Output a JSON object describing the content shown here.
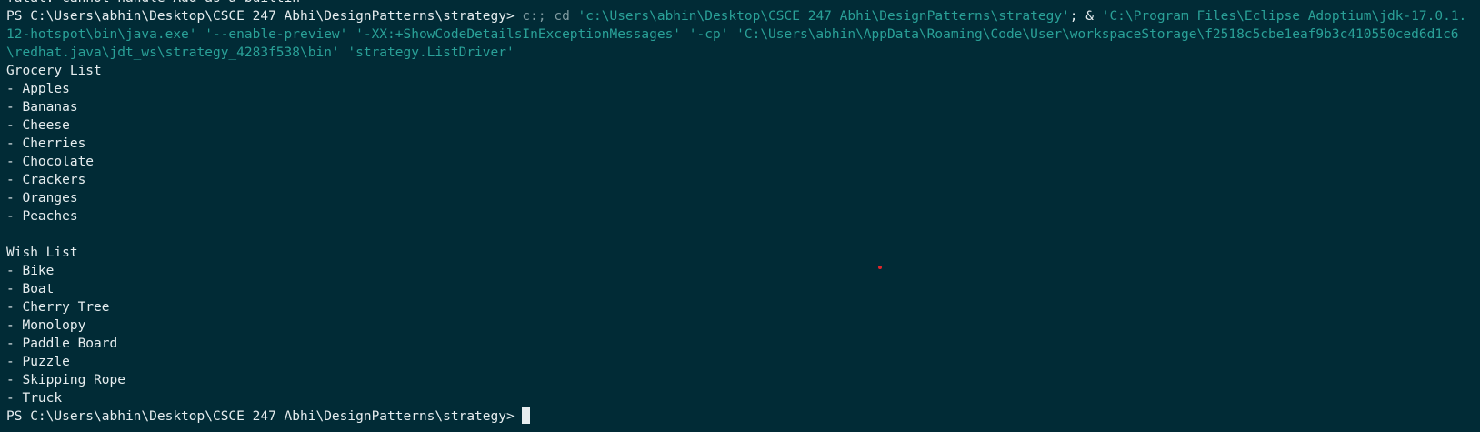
{
  "terminal": {
    "prior_line": "fatal: cannot handle Add as a builtin",
    "prompt": "PS C:\\Users\\abhin\\Desktop\\CSCE 247 Abhi\\DesignPatterns\\strategy>",
    "command": {
      "part1": " c:; cd ",
      "part2": "'c:\\Users\\abhin\\Desktop\\CSCE 247 Abhi\\DesignPatterns\\strategy'",
      "part3": "; & ",
      "part4": "'C:\\Program Files\\Eclipse Adoptium\\jdk-17.0.1.12-hotspot\\bin\\java.exe' '--enable-preview' '-XX:+ShowCodeDetailsInExceptionMessages' '-cp' 'C:\\Users\\abhin\\AppData\\Roaming\\Code\\User\\workspaceStorage\\f2518c5cbe1eaf9b3c410550ced6d1c6\\redhat.java\\jdt_ws\\strategy_4283f538\\bin' 'strategy.ListDriver'"
    },
    "grocery": {
      "title": "Grocery List",
      "items": [
        "- Apples",
        "- Bananas",
        "- Cheese",
        "- Cherries",
        "- Chocolate",
        "- Crackers",
        "- Oranges",
        "- Peaches"
      ]
    },
    "wish": {
      "title": "Wish List",
      "items": [
        "- Bike",
        "- Boat",
        "- Cherry Tree",
        "- Monolopy",
        "- Paddle Board",
        "- Puzzle",
        "- Skipping Rope",
        "- Truck"
      ]
    },
    "final_prompt": "PS C:\\Users\\abhin\\Desktop\\CSCE 247 Abhi\\DesignPatterns\\strategy> "
  },
  "colors": {
    "background": "#012b36",
    "text": "#e6edef",
    "string": "#2aa198",
    "dim": "#7f9aa0",
    "dot": "#e0262b"
  }
}
